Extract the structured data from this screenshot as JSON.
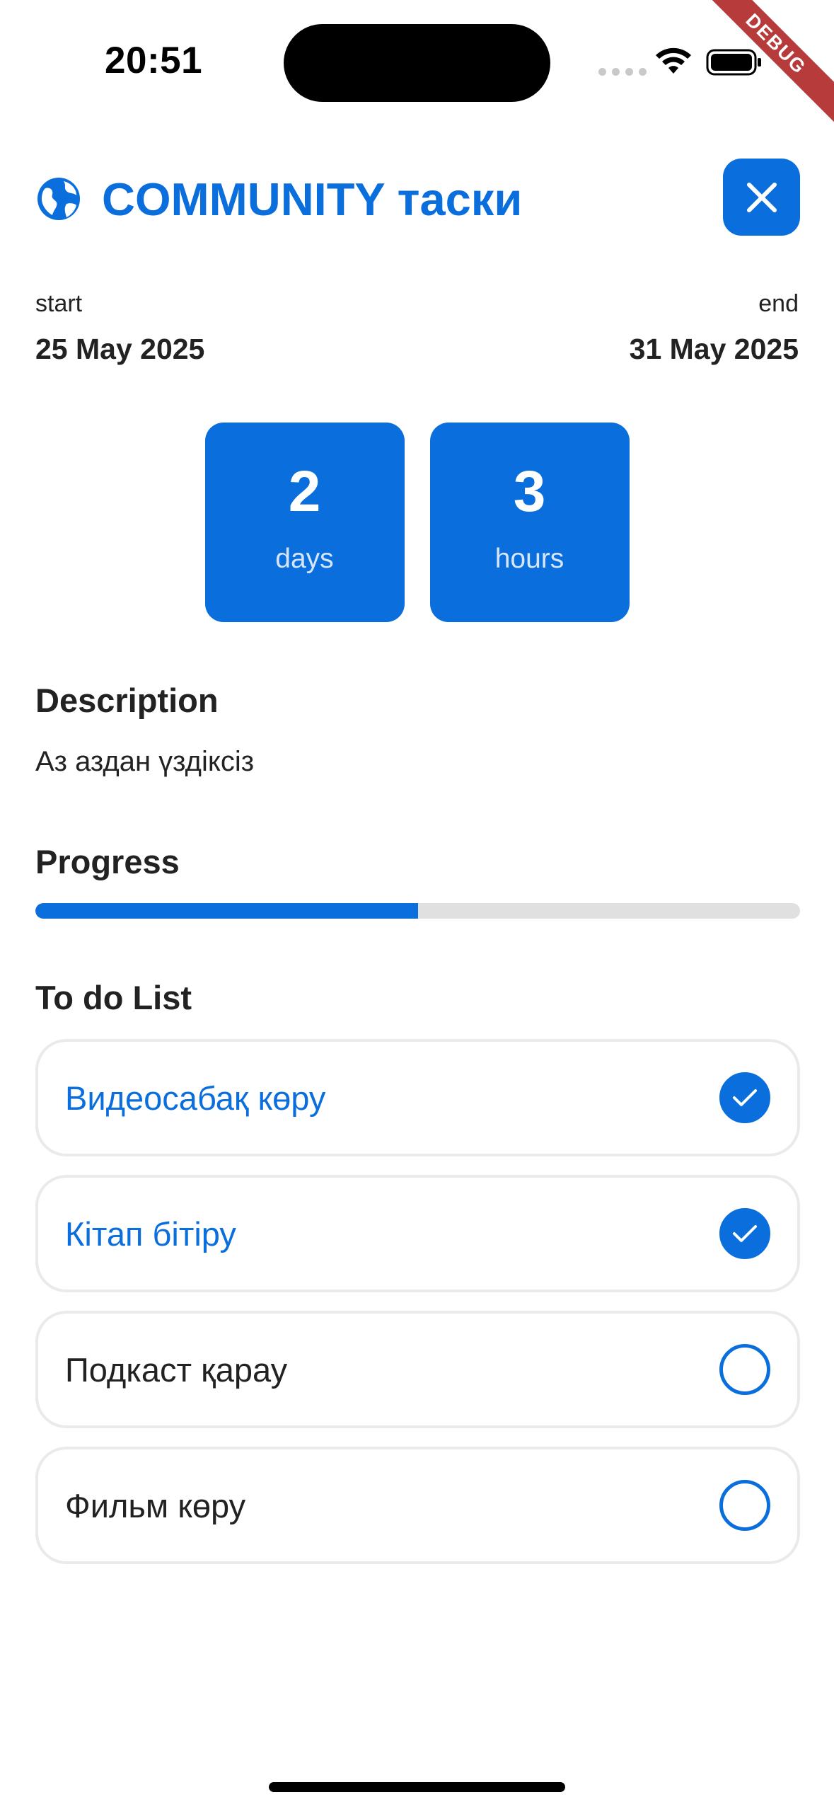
{
  "status_bar": {
    "time": "20:51"
  },
  "debug_banner": "DEBUG",
  "header": {
    "title": "COMMUNITY таски"
  },
  "dates": {
    "start_label": "start",
    "start_value": "25 May 2025",
    "end_label": "end",
    "end_value": "31 May 2025"
  },
  "countdown": [
    {
      "value": "2",
      "unit": "days"
    },
    {
      "value": "3",
      "unit": "hours"
    }
  ],
  "description": {
    "heading": "Description",
    "text": "Аз аздан үздіксіз"
  },
  "progress": {
    "heading": "Progress",
    "fraction": 0.5
  },
  "todo": {
    "heading": "To do List",
    "items": [
      {
        "label": "Видеосабақ көру",
        "done": true
      },
      {
        "label": "Кітап бітіру",
        "done": true
      },
      {
        "label": "Подкаст қарау",
        "done": false
      },
      {
        "label": "Фильм көру",
        "done": false
      }
    ]
  },
  "colors": {
    "accent": "#0a6edc",
    "track": "#e0e0e0",
    "border": "#eaeaea",
    "debug": "#b83b3b"
  }
}
